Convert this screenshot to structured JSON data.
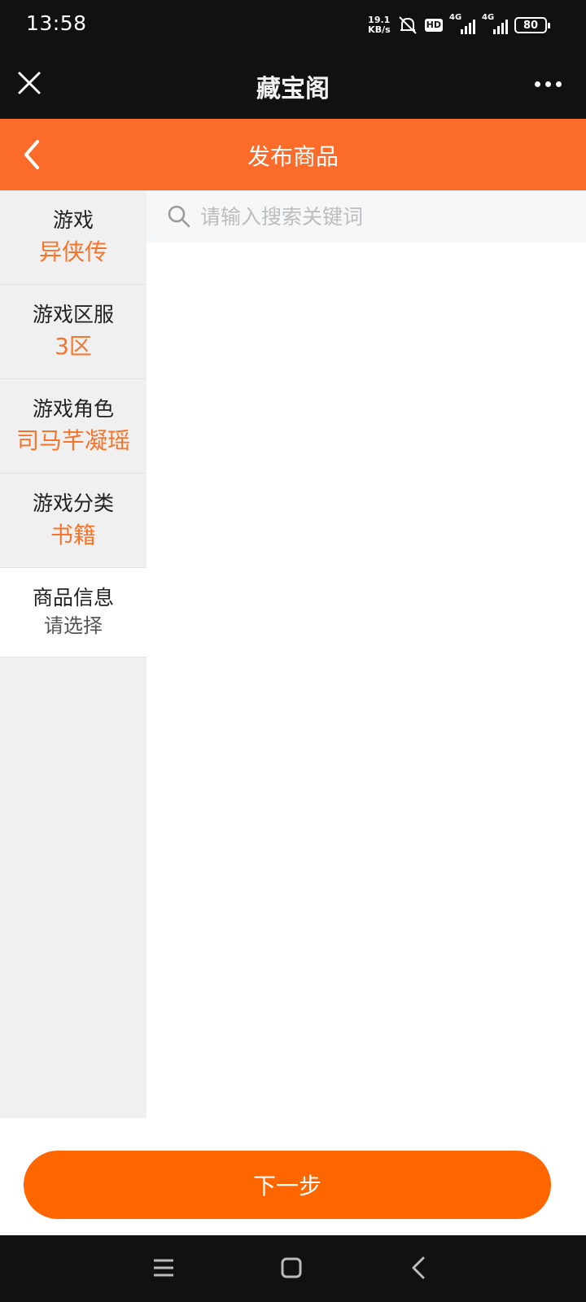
{
  "status_bar": {
    "time": "13:58",
    "net_speed_value": "19.1",
    "net_speed_unit": "KB/s",
    "hd_label": "HD",
    "network_1": "4G",
    "network_2": "4G",
    "battery": "80",
    "icons": [
      "bell-muted-icon",
      "signal-icon",
      "battery-icon"
    ]
  },
  "app_header": {
    "title": "藏宝阁",
    "icons": [
      "close-icon",
      "more-icon"
    ]
  },
  "nav": {
    "title": "发布商品",
    "icon": "back-chevron-icon"
  },
  "sidebar": {
    "items": [
      {
        "label": "游戏",
        "value": "异侠传"
      },
      {
        "label": "游戏区服",
        "value": "3区"
      },
      {
        "label": "游戏角色",
        "value": "司马芊凝瑶"
      },
      {
        "label": "游戏分类",
        "value": "书籍"
      },
      {
        "label": "商品信息",
        "value": "请选择"
      }
    ]
  },
  "search": {
    "placeholder": "请输入搜索关键词",
    "value": ""
  },
  "next_button": {
    "label": "下一步"
  },
  "colors": {
    "accent": "#fb6c2b",
    "button": "#ff6600",
    "value_text": "#f7742b",
    "dark_bar": "#111111"
  }
}
